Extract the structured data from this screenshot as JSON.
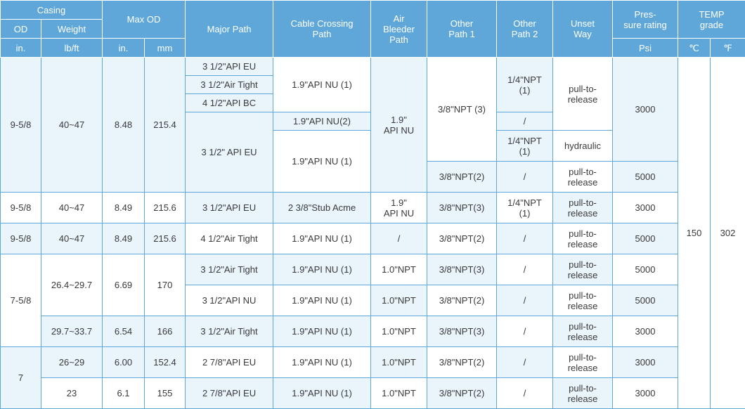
{
  "header": {
    "casing": "Casing",
    "od": "OD",
    "weight": "Weight",
    "max_od": "Max OD",
    "major_path": "Major Path",
    "cable_crossing_1": "Cable Crossing",
    "cable_crossing_2": "Path",
    "air_1": "Air",
    "air_2": "Bleeder Path",
    "other1_1": "Other",
    "other1_2": "Path 1",
    "other2_1": "Other",
    "other2_2": "Path 2",
    "unset_1": "Unset",
    "unset_2": "Way",
    "pres_1": "Pres-",
    "pres_2": "sure rating",
    "temp_1": "TEMP",
    "temp_2": "grade",
    "unit_in": "in.",
    "unit_lbft": "lb/ft",
    "unit_in2": "in.",
    "unit_mm": "mm",
    "unit_psi": "Psi",
    "unit_c": "℃",
    "unit_f": "℉"
  },
  "g1": {
    "od": "9-5/8",
    "weight": "40~47",
    "in": "8.48",
    "mm": "215.4",
    "major_a": "3 1/2\"API EU",
    "major_b": "3 1/2\"Air Tight",
    "major_c": "4 1/2\"API BC",
    "major_d": "3 1/2\" API EU",
    "cable_a": "1.9\"API NU (1)",
    "cable_b": "1.9\"API NU(2)",
    "cable_c": "1.9\"API NU (1)",
    "air_1": "1.9\"",
    "air_2": "API NU",
    "other1_a": "3/8\"NPT (3)",
    "other1_b": "3/8\"NPT(2)",
    "other2_a1": "1/4\"NPT",
    "other2_a2": "(1)",
    "other2_b": "/",
    "other2_c1": "1/4\"NPT",
    "other2_c2": "(1)",
    "other2_d": "/",
    "unset_a1": "pull-to-",
    "unset_a2": "release",
    "unset_b": "hydraulic",
    "unset_c1": "pull-to-",
    "unset_c2": "release",
    "pres_a": "3000",
    "pres_b": "5000"
  },
  "temp": {
    "c": "150",
    "f": "302"
  },
  "rows": [
    {
      "od": "9-5/8",
      "weight": "40~47",
      "in": "8.49",
      "mm": "215.6",
      "major": "3 1/2\"API EU",
      "cable": "2 3/8\"Stub Acme",
      "air1": "1.9\"",
      "air2": "API NU",
      "other1": "3/8\"NPT(3)",
      "other2a": "1/4\"NPT",
      "other2b": "(1)",
      "unset1": "pull-to-",
      "unset2": "release",
      "pres": "3000"
    },
    {
      "od": "9-5/8",
      "weight": "40~47",
      "in": "8.49",
      "mm": "215.6",
      "major": "4 1/2\"Air Tight",
      "cable": "1.9\"API NU (1)",
      "air": "/",
      "other1": "3/8\"NPT(2)",
      "other2": "/",
      "unset1": "pull-to-",
      "unset2": "release",
      "pres": "5000"
    }
  ],
  "g2": {
    "od": "7-5/8",
    "w_a": "26.4~29.7",
    "in_a": "6.69",
    "mm_a": "170",
    "w_b": "29.7~33.7",
    "in_b": "6.54",
    "mm_b": "166",
    "r": [
      {
        "major": "3 1/2\"Air Tight",
        "cable": "1.9\"API NU (1)",
        "air": "1.0\"NPT",
        "other1": "3/8\"NPT(3)",
        "other2": "/",
        "unset1": "pull-to-",
        "unset2": "release",
        "pres": "5000"
      },
      {
        "major": "3 1/2\"API NU",
        "cable": "1.9\"API NU (1)",
        "air": "1.0\"NPT",
        "other1": "3/8\"NPT(2)",
        "other2": "/",
        "unset1": "pull-to-",
        "unset2": "release",
        "pres": "5000"
      },
      {
        "major": "3 1/2\"Air Tight",
        "cable": "1.9\"API NU (1)",
        "air": "1.0\"NPT",
        "other1": "3/8\"NPT(3)",
        "other2": "/",
        "unset1": "pull-to-",
        "unset2": "release",
        "pres": "3000"
      }
    ]
  },
  "g3": {
    "od": "7",
    "r": [
      {
        "weight": "26~29",
        "in": "6.00",
        "mm": "152.4",
        "major": "2 7/8\"API EU",
        "cable": "1.9\"API NU (1)",
        "air": "1.0\"NPT",
        "other1": "3/8\"NPT(2)",
        "other2": "/",
        "unset1": "pull-to-",
        "unset2": "release",
        "pres": "3000"
      },
      {
        "weight": "23",
        "in": "6.1",
        "mm": "155",
        "major": "2 7/8\"API EU",
        "cable": "1.9\"API NU (1)",
        "air": "1.0\"NPT",
        "other1": "3/8\"NPT(2)",
        "other2": "/",
        "unset1": "pull-to-",
        "unset2": "release",
        "pres": "3000"
      }
    ]
  }
}
